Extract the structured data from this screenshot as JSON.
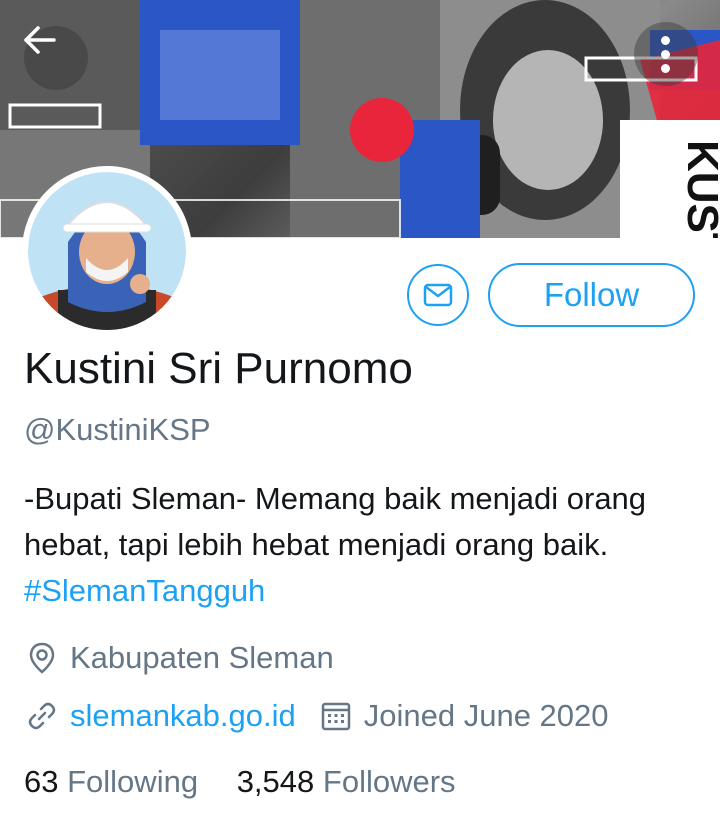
{
  "header": {
    "back_icon": "arrow-left-icon",
    "more_icon": "more-vertical-icon",
    "banner_text": "KUSTINI"
  },
  "profile": {
    "name": "Kustini Sri Purnomo",
    "handle": "@KustiniKSP",
    "bio_text": "-Bupati Sleman-  Memang baik menjadi orang hebat, tapi lebih hebat menjadi orang baik.",
    "bio_hashtag": "#SlemanTangguh",
    "location": "Kabupaten Sleman",
    "website": "slemankab.go.id",
    "joined": "Joined June 2020"
  },
  "actions": {
    "message_icon": "mail-icon",
    "follow_label": "Follow"
  },
  "stats": {
    "following_count": "63",
    "following_label": "Following",
    "followers_count": "3,548",
    "followers_label": "Followers"
  },
  "colors": {
    "accent": "#1da1f2",
    "secondary_text": "#657786",
    "primary_text": "#14171a",
    "banner_blue": "#2a56c6",
    "banner_red": "#e8253a"
  }
}
